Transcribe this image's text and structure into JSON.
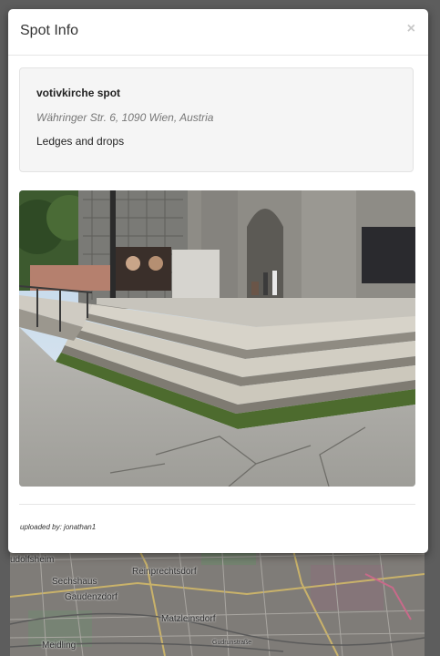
{
  "modal": {
    "title": "Spot Info",
    "close_glyph": "×",
    "close_icon": "close-icon"
  },
  "spot": {
    "name": "votivkirche spot",
    "address": "Währinger Str. 6, 1090 Wien, Austria",
    "description": "Ledges and drops",
    "photo_subject": "church-steps-ledge-photo"
  },
  "footer": {
    "uploaded_by": "uploaded by: jonathan1"
  },
  "map": {
    "labels": [
      "udolfsheim",
      "Sechshaus",
      "Reinprechtsdorf",
      "Gaudenzdorf",
      "Matzleinsdorf",
      "Meidling",
      "Gudrunstraße"
    ]
  }
}
